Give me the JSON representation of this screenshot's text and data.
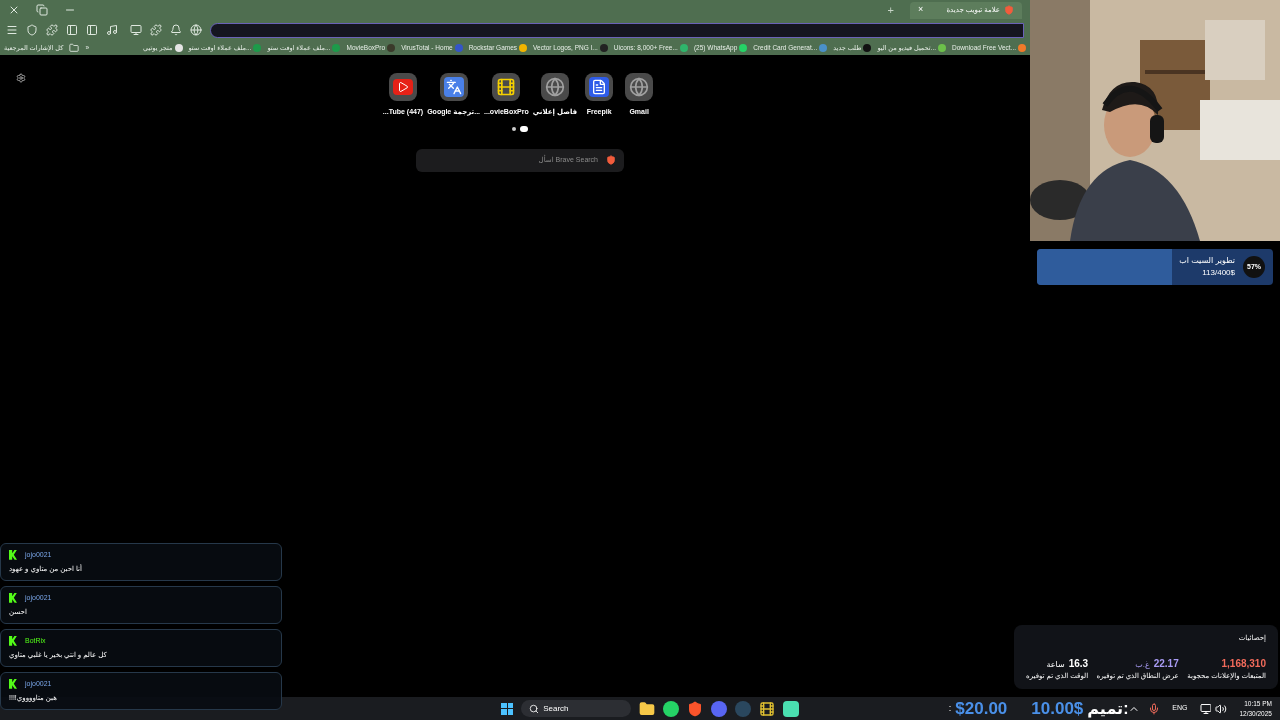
{
  "tab": {
    "title": "علامة تبويب جديدة",
    "close": "×",
    "selected": true
  },
  "new_tab": "+",
  "bookmarks_all": "كل الإشارات المرجعية",
  "bookmarks_more": "»",
  "bookmarks": [
    {
      "label": "Download Free Vect...",
      "color": "#f07a2a"
    },
    {
      "label": "تحميل فيديو من اليو...",
      "color": "#6cc04a"
    },
    {
      "label": "طلب جديد",
      "color": "#111111"
    },
    {
      "label": "Credit Card Generat...",
      "color": "#4a90c8"
    },
    {
      "label": "(25) WhatsApp",
      "color": "#25d366"
    },
    {
      "label": "Uicons: 8,000+ Free...",
      "color": "#2fb56b"
    },
    {
      "label": "Vector Logos, PNG I...",
      "color": "#222222"
    },
    {
      "label": "Rockstar Games",
      "color": "#f0b400"
    },
    {
      "label": "VirusTotal - Home",
      "color": "#3455c8"
    },
    {
      "label": "MovieBoxPro",
      "color": "#3a3a2a"
    },
    {
      "label": "ملف عملاء اوفت ستو...",
      "color": "#1d9a4a"
    },
    {
      "label": "ملف عملاء اوفت ستو...",
      "color": "#1d9a4a"
    },
    {
      "label": "متجر يوتيي",
      "color": "#e5e5e5"
    }
  ],
  "speed_dial": [
    {
      "label": "Gmail",
      "kind": "globe"
    },
    {
      "label": "Freepik",
      "kind": "doc"
    },
    {
      "label": "فاصل إعلاني",
      "kind": "globe"
    },
    {
      "label": "...ovieBoxPro",
      "kind": "film"
    },
    {
      "label": "Google ترجمة...",
      "kind": "translate"
    },
    {
      "label": "...Tube (447)",
      "kind": "video"
    }
  ],
  "pager": [
    {
      "selected": false
    },
    {
      "selected": true
    }
  ],
  "search": {
    "placeholder": "اسأل Brave Search"
  },
  "goal": {
    "title": "تطوير السيت اب",
    "amount": "113/400$",
    "percent": "57%",
    "level": 0.57
  },
  "chat": [
    {
      "user": "jojo0021",
      "text": "أنا احبن من متاوي و عهود"
    },
    {
      "user": "jojo0021",
      "text": "احسن"
    },
    {
      "user": "BotRix",
      "text": "كل عالم و انتي بخير يا غلبي متاوي"
    },
    {
      "user": "jojo0021",
      "text": "!!!!هبن متاووووي"
    }
  ],
  "stats": {
    "title": "إحصائيات",
    "items": [
      {
        "value": "1,168,310",
        "label": "المتبعات والإعلانات محجوبة",
        "color": "#f26b5b"
      },
      {
        "value": "22.17",
        "unit": "غ.ب",
        "label": "عرض النطاق الذي تم توفيره",
        "color": "#a99cf5"
      },
      {
        "value": "16.3",
        "unit": "ساعة",
        "label": "الوقت الذي تم توفيره",
        "color": "#ffffff"
      }
    ]
  },
  "taskbar": {
    "search": "Search",
    "apps": [
      {
        "kind": "folder"
      },
      {
        "kind": "whatsapp"
      },
      {
        "kind": "brave"
      },
      {
        "kind": "discord"
      },
      {
        "kind": "steam"
      },
      {
        "kind": "film"
      },
      {
        "kind": "terminal"
      }
    ],
    "separator": ":",
    "donation_last": "$20.00",
    "donation_name": "تميم:",
    "donation_amount": "10.00$",
    "lang": "ENG",
    "time": "10:15 PM",
    "date": "12/30/2025"
  }
}
